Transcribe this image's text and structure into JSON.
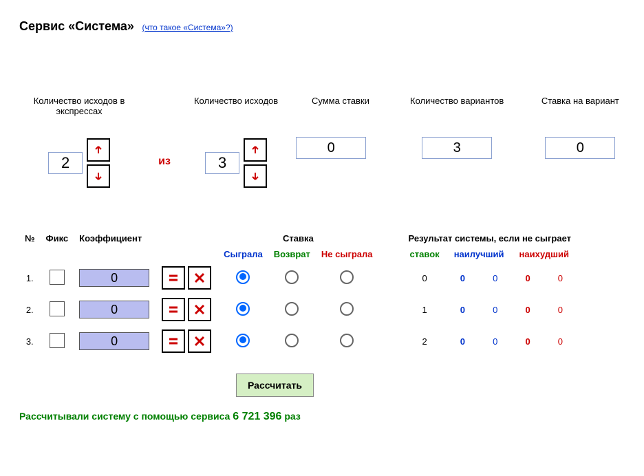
{
  "header": {
    "title": "Сервис «Система»",
    "help_link": "(что такое «Система»?)"
  },
  "controls": {
    "express_label": "Количество исходов в экспрессах",
    "express_value": "2",
    "iz": "из",
    "outcomes_label": "Количество исходов",
    "outcomes_value": "3",
    "sum_label": "Сумма ставки",
    "sum_value": "0",
    "variants_label": "Количество вариантов",
    "variants_value": "3",
    "per_variant_label": "Ставка на вариант",
    "per_variant_value": "0"
  },
  "table": {
    "h_num": "№",
    "h_fix": "Фикс",
    "h_coef": "Коэффициент",
    "h_bet": "Ставка",
    "h_result": "Результат системы, если не сыграет",
    "sub_played": "Сыграла",
    "sub_return": "Возврат",
    "sub_not": "Не сыграла",
    "sub_stavok": "ставок",
    "sub_best": "наилучший",
    "sub_worst": "наихудший",
    "rows": [
      {
        "n": "1.",
        "coef": "0",
        "stavok": "0",
        "r1": "0",
        "r2": "0",
        "r3": "0",
        "r4": "0"
      },
      {
        "n": "2.",
        "coef": "0",
        "stavok": "1",
        "r1": "0",
        "r2": "0",
        "r3": "0",
        "r4": "0"
      },
      {
        "n": "3.",
        "coef": "0",
        "stavok": "2",
        "r1": "0",
        "r2": "0",
        "r3": "0",
        "r4": "0"
      }
    ]
  },
  "calc_button": "Рассчитать",
  "footer": {
    "pre": "Рассчитывали систему с помощью сервиса ",
    "count": "6 721 396",
    "post": " раз"
  }
}
